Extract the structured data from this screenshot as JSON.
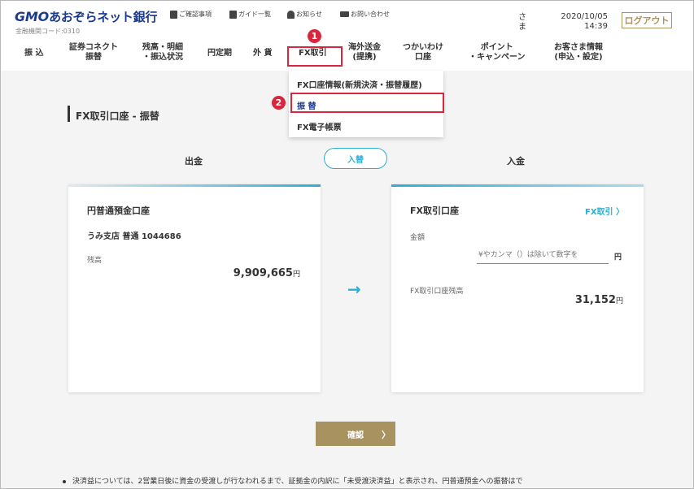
{
  "header": {
    "logo_brand": "GMO",
    "logo_text": "あおぞらネット銀行",
    "bank_code": "金融機関コード:0310",
    "util": [
      {
        "icon": "document-icon",
        "label": "ご確認事項"
      },
      {
        "icon": "book-icon",
        "label": "ガイド一覧"
      },
      {
        "icon": "bell-icon",
        "label": "お知らせ"
      },
      {
        "icon": "mail-icon",
        "label": "お問い合わせ"
      }
    ],
    "user_suffix_1": "さ",
    "user_suffix_2": "ま",
    "date": "2020/10/05",
    "time": "14:39",
    "logout_label": "ログアウト"
  },
  "nav": {
    "items": [
      {
        "line1": "振 込",
        "line2": ""
      },
      {
        "line1": "証券コネクト",
        "line2": "振替"
      },
      {
        "line1": "残高・明細",
        "line2": "・振込状況"
      },
      {
        "line1": "円定期",
        "line2": ""
      },
      {
        "line1": "外 貨",
        "line2": ""
      },
      {
        "line1": "FX取引",
        "line2": ""
      },
      {
        "line1": "海外送金",
        "line2": "(提携)"
      },
      {
        "line1": "つかいわけ",
        "line2": "口座"
      },
      {
        "line1": "ポイント",
        "line2": "・キャンペーン"
      },
      {
        "line1": "お客さま情報",
        "line2": "(申込・設定)"
      }
    ]
  },
  "annotations": {
    "step1": "1",
    "step2": "2"
  },
  "dropdown": {
    "items": [
      "FX口座情報(新規決済・振替履歴)",
      "振 替",
      "FX電子帳票"
    ]
  },
  "main": {
    "page_title": "FX取引口座 - 振替",
    "withdraw_label": "出金",
    "deposit_label": "入金",
    "swap_label": "入替",
    "left_card": {
      "account_type": "円普通預金口座",
      "branch": "うみ支店 普通 1044686",
      "balance_label": "残高",
      "balance_value": "9,909,665",
      "currency": "円"
    },
    "right_card": {
      "account_type": "FX取引口座",
      "fx_link": "FX取引 〉",
      "amount_label": "金額",
      "amount_placeholder": "¥やカンマ（）は除いて数字を",
      "amount_unit": "円",
      "fx_balance_label": "FX取引口座残高",
      "fx_balance_value": "31,152",
      "currency": "円"
    },
    "arrow": "→",
    "confirm_label": "確認",
    "confirm_chevron": "〉"
  },
  "note": {
    "text": "決済益については、2営業日後に資金の受渡しが行なわれるまで、証拠金の内訳に「未受渡決済益」と表示され、円普通預金への振替はで"
  },
  "colors": {
    "brand_blue": "#1a3a8c",
    "accent_cyan": "#2eaed2",
    "gold": "#a89360",
    "annotation_red": "#d9263c"
  }
}
